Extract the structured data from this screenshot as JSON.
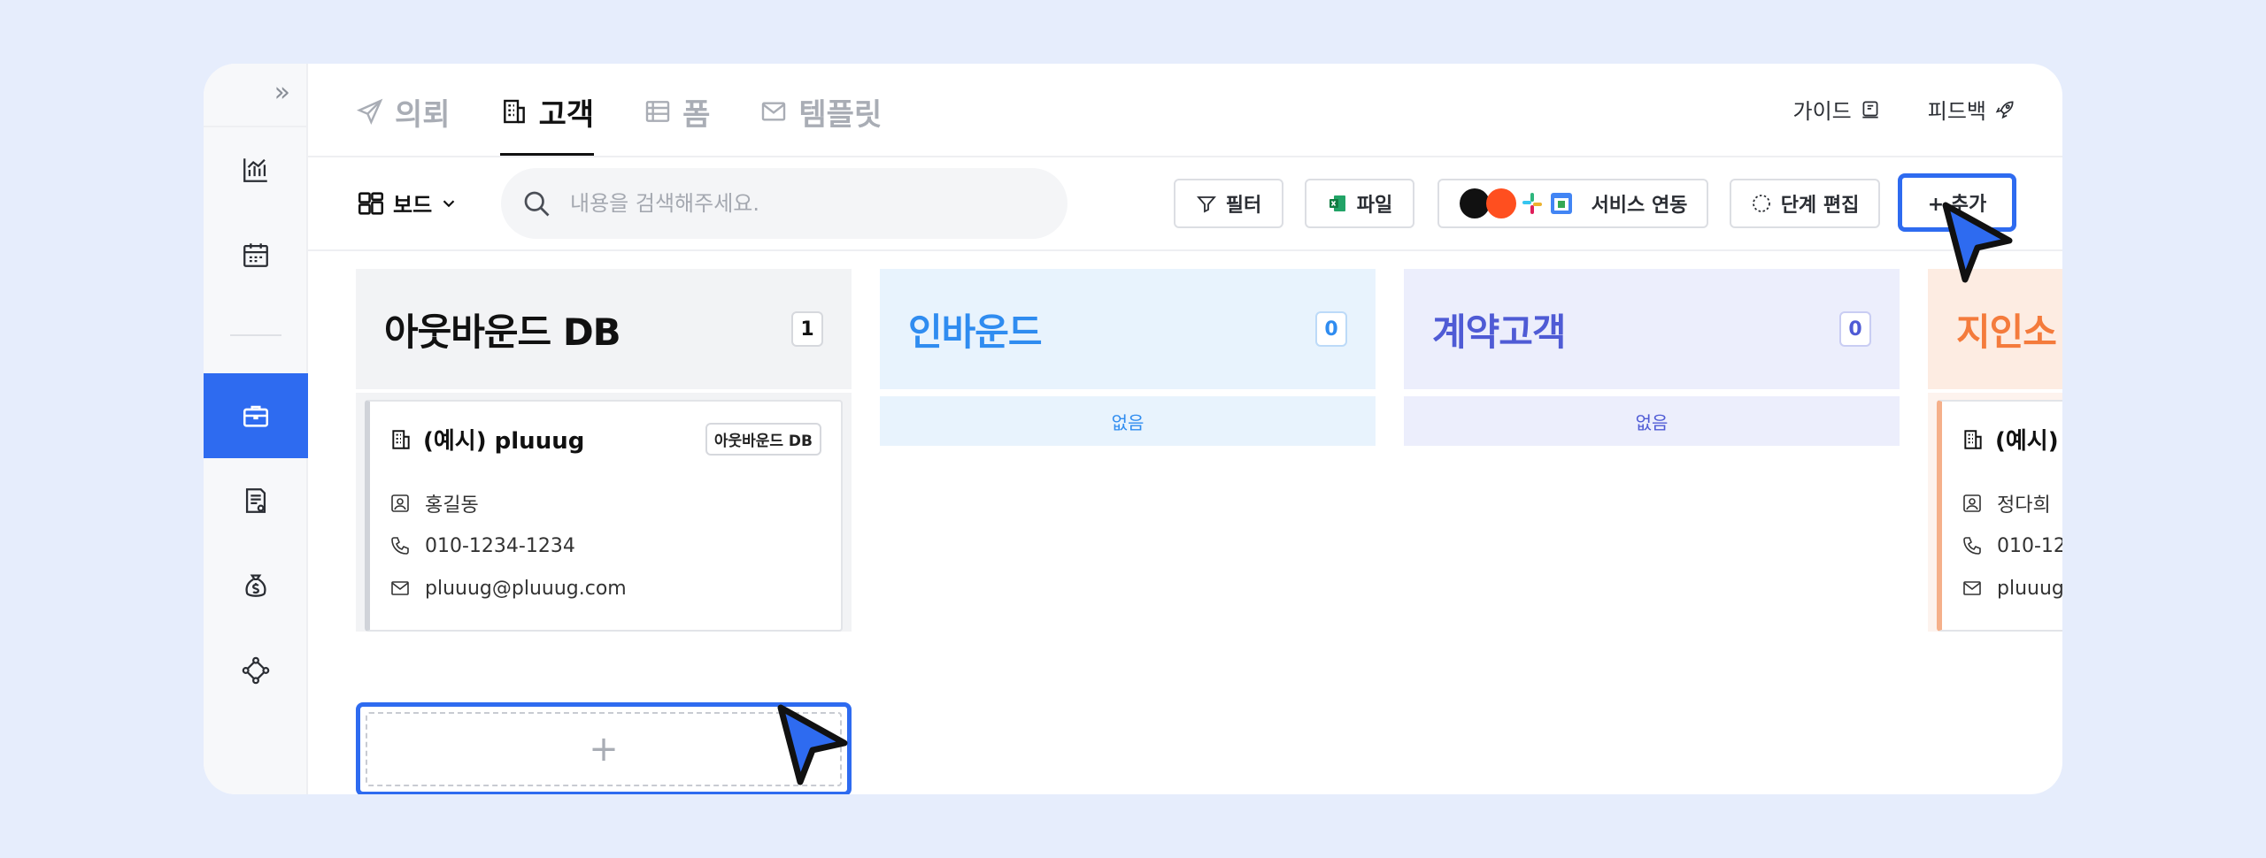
{
  "sidebar": {
    "expand_icon": "double-chevron-right-icon",
    "items": [
      {
        "icon": "chart-icon"
      },
      {
        "icon": "calendar-icon"
      },
      {
        "icon": "briefcase-icon",
        "active": true
      },
      {
        "icon": "document-icon"
      },
      {
        "icon": "money-bag-icon"
      },
      {
        "icon": "network-icon"
      }
    ],
    "accent": "#2e6bf0"
  },
  "tabs": [
    {
      "label": "의뢰",
      "icon": "send-icon"
    },
    {
      "label": "고객",
      "icon": "building-icon",
      "active": true
    },
    {
      "label": "폼",
      "icon": "list-icon"
    },
    {
      "label": "템플릿",
      "icon": "mail-icon"
    }
  ],
  "top_links": {
    "guide": "가이드",
    "feedback": "피드백"
  },
  "toolbar": {
    "view_label": "보드",
    "search_placeholder": "내용을 검색해주세요.",
    "filter_label": "필터",
    "file_label": "파일",
    "integration_label": "서비스 연동",
    "stage_edit_label": "단계 편집",
    "add_label": "+ 추가"
  },
  "columns": [
    {
      "title": "아웃바운드 DB",
      "count": "1",
      "title_color": "#111111",
      "bg": "#f2f3f5",
      "cards": [
        {
          "title": "(예시) pluuug",
          "badge": "아웃바운드 DB",
          "name": "홍길동",
          "phone": "010-1234-1234",
          "email": "pluuug@pluuug.com"
        }
      ],
      "add_symbol": "+"
    },
    {
      "title": "인바운드",
      "count": "0",
      "title_color": "#2f8cf0",
      "bg": "#e8f3fd",
      "empty_label": "없음"
    },
    {
      "title": "계약고객",
      "count": "0",
      "title_color": "#4f5bd5",
      "bg": "#eceefc",
      "empty_label": "없음"
    },
    {
      "title": "지인소",
      "count": "",
      "title_color": "#f47b3c",
      "bg": "#fdece2",
      "cards": [
        {
          "title": "(예시)",
          "name": "정다희",
          "phone": "010-12",
          "email": "pluuug"
        }
      ]
    }
  ]
}
